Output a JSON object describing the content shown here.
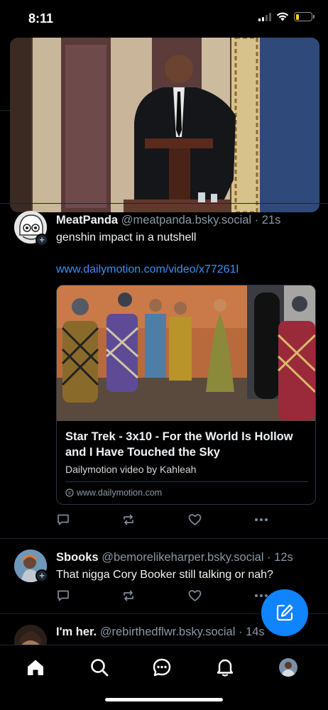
{
  "status_bar": {
    "time": "8:11"
  },
  "feed": {
    "posts": [
      {
        "display_name": "MeatPanda",
        "handle": "@meatpanda.bsky.social",
        "time": "· 21s",
        "text": "genshin impact in a nutshell",
        "link": "www.dailymotion.com/video/x77261l",
        "embed": {
          "title": "Star Trek - 3x10 - For the World Is Hollow and I Have Touched the Sky",
          "description": "Dailymotion video by Kahleah",
          "domain": "www.dailymotion.com"
        }
      },
      {
        "display_name": "Sbooks",
        "handle": "@bemorelikeharper.bsky.social",
        "time": "· 12s",
        "text": "That nigga Cory Booker still talking or nah?"
      },
      {
        "display_name": "I'm her.",
        "handle": "@rebirthedflwr.bsky.social",
        "time": "· 14s"
      }
    ]
  },
  "icons": {
    "reply": "reply-icon",
    "repost": "repost-icon",
    "like": "heart-icon",
    "more": "more-icon",
    "compose": "compose-icon",
    "nav": [
      "home-icon",
      "search-icon",
      "chat-icon",
      "bell-icon",
      "profile-avatar"
    ]
  },
  "colors": {
    "accent": "#1083fe",
    "link": "#3e8ff7",
    "muted": "#8b98a5",
    "battery": "#ffd60a"
  }
}
